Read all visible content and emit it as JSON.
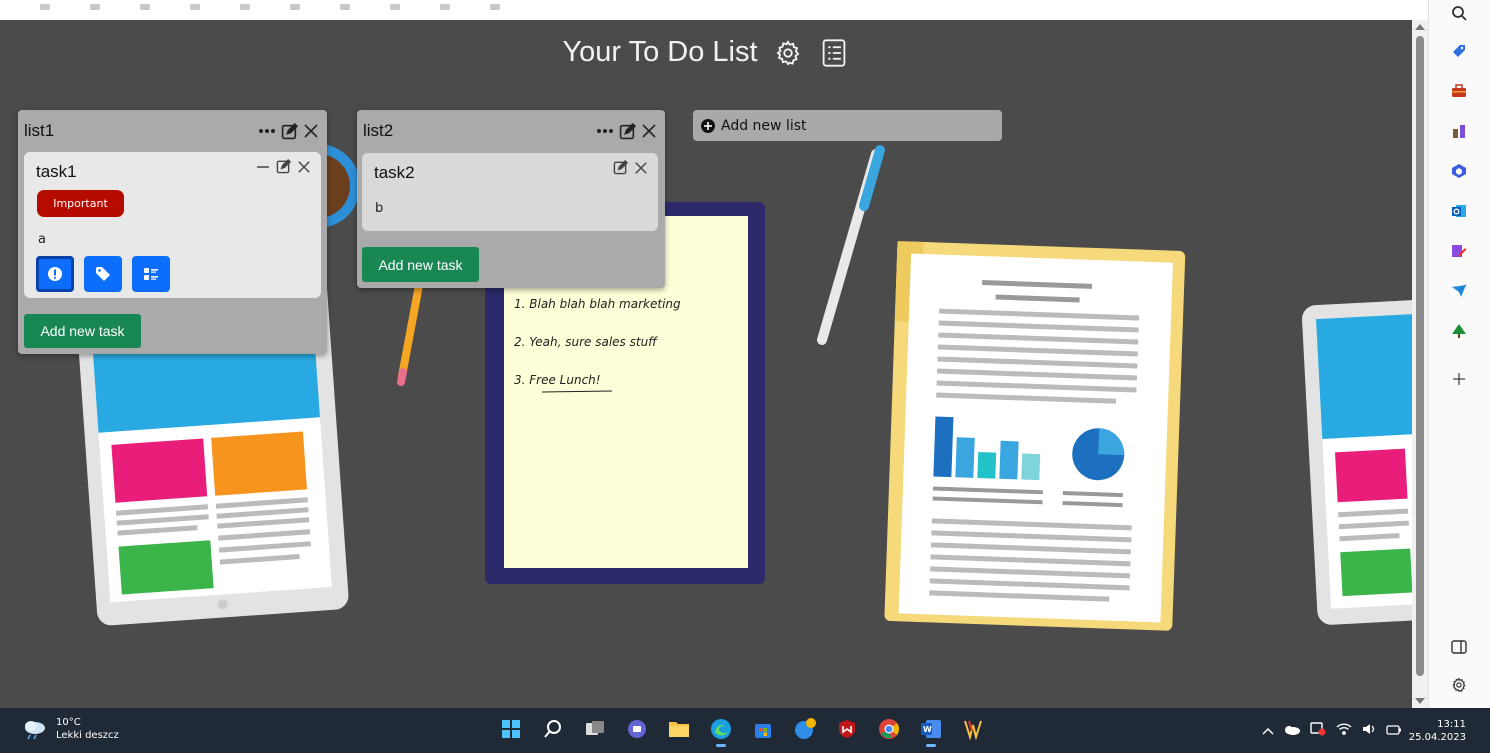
{
  "app": {
    "title": "Your To Do List",
    "add_list_label": "Add new list"
  },
  "lists": [
    {
      "title": "list1",
      "tasks": [
        {
          "title": "task1",
          "badge": "Important",
          "description": "a"
        }
      ],
      "add_task_label": "Add new task"
    },
    {
      "title": "list2",
      "tasks": [
        {
          "title": "task2",
          "description": "b"
        }
      ],
      "add_task_label": "Add new task"
    }
  ],
  "illustration": {
    "note_lines": [
      "1. Blah blah blah marketing",
      "2. Yeah, sure sales stuff",
      "3. Free Lunch!"
    ]
  },
  "taskbar": {
    "weather_temp": "10°C",
    "weather_desc": "Lekki deszcz",
    "time": "13:11",
    "date": "25.04.2023"
  },
  "colors": {
    "background": "#4b4b4b",
    "list_bg": "#aaaaaa",
    "task_bg": "#e8e8e8",
    "important_badge": "#b60b00",
    "primary": "#0d6efd",
    "success": "#198754",
    "taskbar": "#1f2a36"
  }
}
